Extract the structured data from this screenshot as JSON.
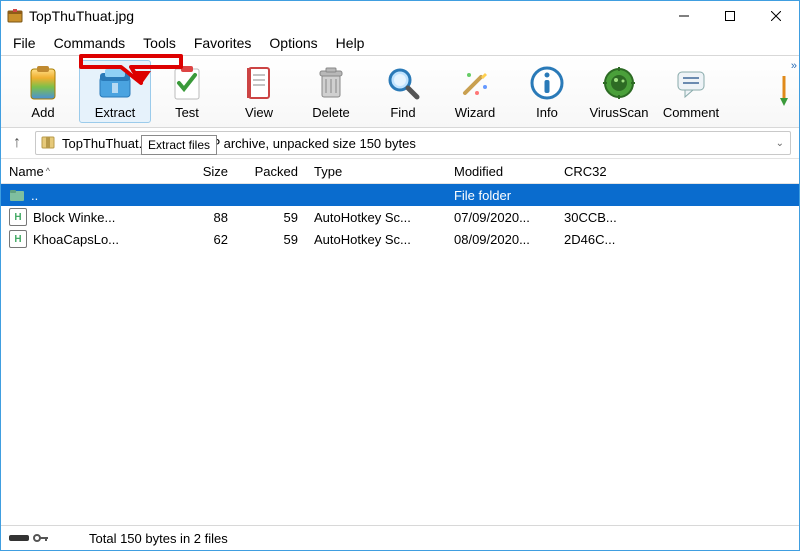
{
  "window": {
    "title": "TopThuThuat.jpg"
  },
  "menu": {
    "file": "File",
    "commands": "Commands",
    "tools": "Tools",
    "favorites": "Favorites",
    "options": "Options",
    "help": "Help"
  },
  "toolbar": {
    "add": "Add",
    "extract": "Extract",
    "test": "Test",
    "view": "View",
    "delete": "Delete",
    "find": "Find",
    "wizard": "Wizard",
    "info": "Info",
    "virusscan": "VirusScan",
    "comment": "Comment"
  },
  "tooltip": {
    "extract": "Extract files"
  },
  "pathbar": {
    "text": "TopThuThuat.jpg - SFX ZIP archive, unpacked size 150 bytes"
  },
  "columns": {
    "name": "Name",
    "size": "Size",
    "packed": "Packed",
    "type": "Type",
    "modified": "Modified",
    "crc32": "CRC32"
  },
  "rows": {
    "parent": {
      "label": "..",
      "type": "File folder"
    },
    "r1": {
      "name": "Block Winke...",
      "size": "88",
      "packed": "59",
      "type": "AutoHotkey Sc...",
      "modified": "07/09/2020...",
      "crc": "30CCB..."
    },
    "r2": {
      "name": "KhoaCapsLo...",
      "size": "62",
      "packed": "59",
      "type": "AutoHotkey Sc...",
      "modified": "08/09/2020...",
      "crc": "2D46C..."
    }
  },
  "status": {
    "total": "Total 150 bytes in 2 files"
  }
}
